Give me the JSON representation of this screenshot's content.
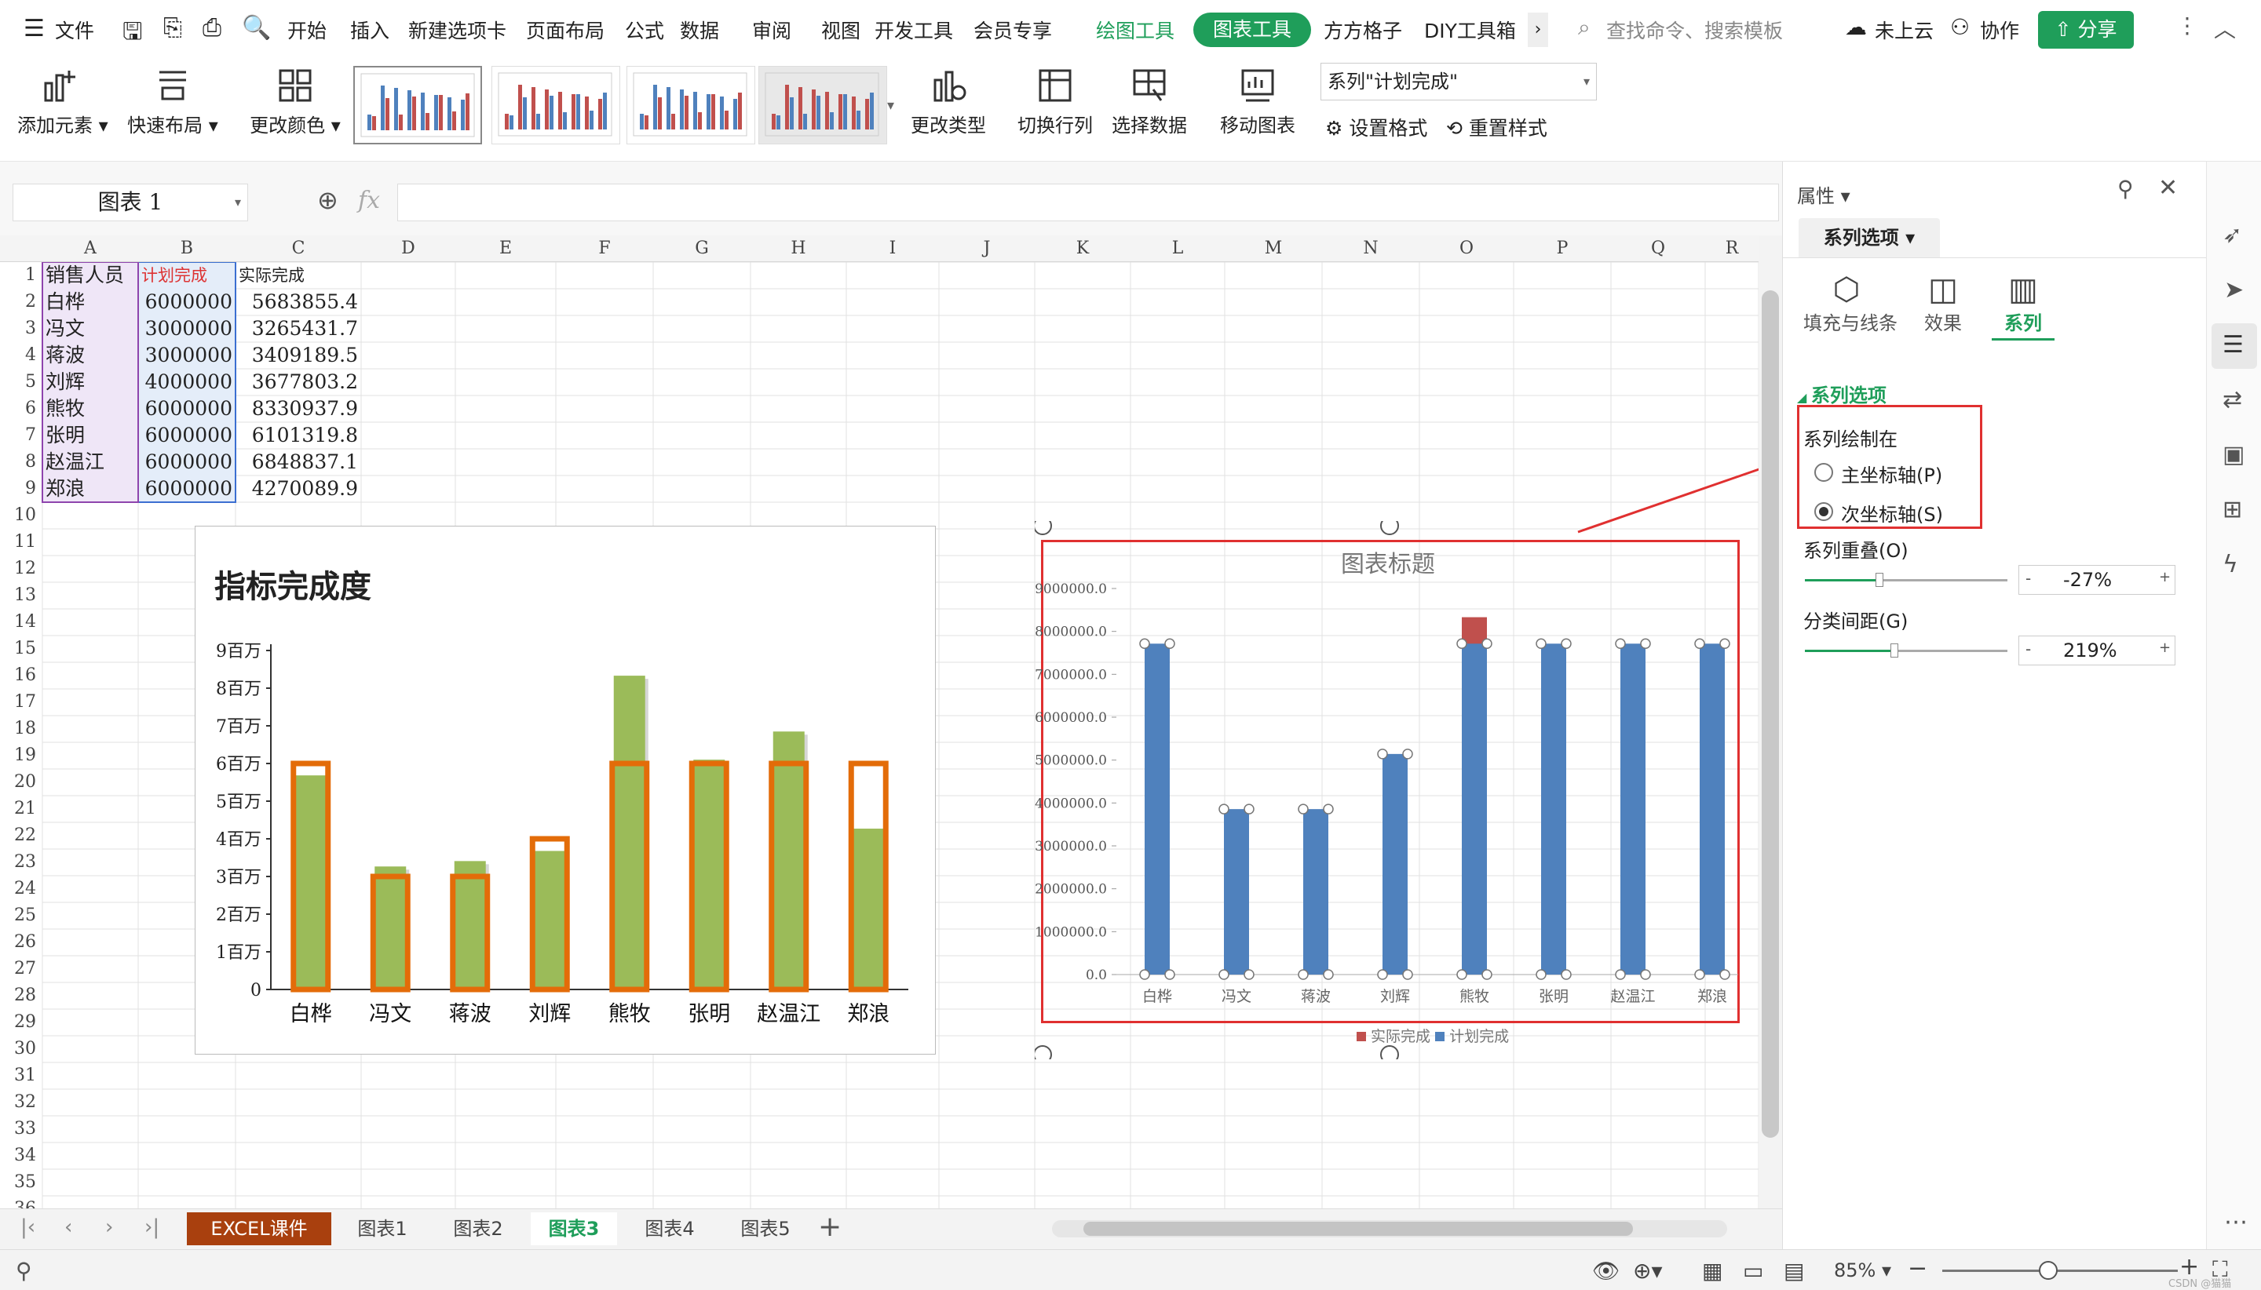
{
  "menu": {
    "file": "文件",
    "items": [
      "开始",
      "插入",
      "新建选项卡",
      "页面布局",
      "公式",
      "数据",
      "审阅",
      "视图",
      "开发工具",
      "会员专享"
    ],
    "drawing_tools": "绘图工具",
    "chart_tools": "图表工具",
    "fangfang": "方方格子",
    "diy": "DIY工具箱",
    "more": "›",
    "search_placeholder": "查找命令、搜索模板",
    "cloud": "未上云",
    "collab": "协作",
    "share": "分享"
  },
  "ribbon": {
    "add_element": "添加元素",
    "quick_layout": "快速布局",
    "change_color": "更改颜色",
    "change_type": "更改类型",
    "switch_rowcol": "切换行列",
    "select_data": "选择数据",
    "move_chart": "移动图表",
    "series_select": "系列\"计划完成\"",
    "set_format": "设置格式",
    "reset_style": "重置样式"
  },
  "formula_bar": {
    "name_box": "图表 1",
    "fx": "fx",
    "value": ""
  },
  "columns": [
    "A",
    "B",
    "C",
    "D",
    "E",
    "F",
    "G",
    "H",
    "I",
    "J",
    "K",
    "L",
    "M",
    "N",
    "O",
    "P",
    "Q",
    "R"
  ],
  "rows": [
    "1",
    "2",
    "3",
    "4",
    "5",
    "6",
    "7",
    "8",
    "9",
    "10",
    "11",
    "12",
    "13",
    "14",
    "15",
    "16",
    "17",
    "18",
    "19",
    "20",
    "21",
    "22",
    "23",
    "24",
    "25",
    "26",
    "27",
    "28",
    "29",
    "30",
    "31",
    "32",
    "33",
    "34",
    "35",
    "36"
  ],
  "table": {
    "headers": [
      "销售人员",
      "计划完成",
      "实际完成"
    ],
    "rows": [
      [
        "白桦",
        "6000000",
        "5683855.4"
      ],
      [
        "冯文",
        "3000000",
        "3265431.7"
      ],
      [
        "蒋波",
        "3000000",
        "3409189.5"
      ],
      [
        "刘辉",
        "4000000",
        "3677803.2"
      ],
      [
        "熊牧",
        "6000000",
        "8330937.9"
      ],
      [
        "张明",
        "6000000",
        "6101319.8"
      ],
      [
        "赵温江",
        "6000000",
        "6848837.1"
      ],
      [
        "郑浪",
        "6000000",
        "4270089.9"
      ]
    ]
  },
  "chart_data": [
    {
      "type": "bar",
      "title": "指标完成度",
      "categories": [
        "白桦",
        "冯文",
        "蒋波",
        "刘辉",
        "熊牧",
        "张明",
        "赵温江",
        "郑浪"
      ],
      "series": [
        {
          "values": [
            5683855.4,
            3265431.7,
            3409189.5,
            3677803.2,
            8330937.9,
            6101319.8,
            6848837.1,
            4270089.9
          ]
        },
        {
          "values": [
            6000000,
            3000000,
            3000000,
            4000000,
            6000000,
            6000000,
            6000000,
            6000000
          ]
        }
      ],
      "ylim": [
        0,
        9000000
      ],
      "yticks": [
        "0",
        "1百万",
        "2百万",
        "3百万",
        "4百万",
        "5百万",
        "6百万",
        "7百万",
        "8百万",
        "9百万"
      ],
      "colors": {
        "actual": "#9bbb59",
        "plan": "#e36c09"
      },
      "grid": false
    },
    {
      "type": "bar",
      "title": "图表标题",
      "categories": [
        "白桦",
        "冯文",
        "蒋波",
        "刘辉",
        "熊牧",
        "张明",
        "赵温江",
        "郑浪"
      ],
      "series": [
        {
          "name": "实际完成",
          "values": [
            5683855.4,
            3265431.7,
            3409189.5,
            3677803.2,
            8330937.9,
            6101319.8,
            6848837.1,
            4270089.9
          ]
        },
        {
          "name": "计划完成",
          "values": [
            6000000,
            3000000,
            3000000,
            4000000,
            6000000,
            6000000,
            6000000,
            6000000
          ]
        }
      ],
      "ylim": [
        0,
        9000000
      ],
      "secondary_ylim": [
        0,
        7000000
      ],
      "yticks": [
        "0.0",
        "1000000.0",
        "2000000.0",
        "3000000.0",
        "4000000.0",
        "5000000.0",
        "6000000.0",
        "7000000.0",
        "8000000.0",
        "9000000.0"
      ],
      "colors": {
        "actual": "#c0504d",
        "plan": "#4f81bd"
      },
      "legend": "bottom",
      "grid": false
    }
  ],
  "sheet_tabs": [
    "EXCEL课件",
    "图表1",
    "图表2",
    "图表3",
    "图表4",
    "图表5"
  ],
  "active_tab": "图表3",
  "panel": {
    "title": "属性",
    "section_tab": "系列选项",
    "subtabs": [
      "填充与线条",
      "效果",
      "系列"
    ],
    "section_header": "系列选项",
    "plot_on": "系列绘制在",
    "primary_axis": "主坐标轴(P)",
    "secondary_axis": "次坐标轴(S)",
    "selected_axis": "secondary",
    "overlap_label": "系列重叠(O)",
    "overlap_value": "-27%",
    "overlap_level": 0.37,
    "gap_label": "分类间距(G)",
    "gap_value": "219%",
    "gap_level": 0.44
  },
  "status": {
    "zoom": "85%",
    "zoom_level": 0.45,
    "watermark": "CSDN @猫猫"
  },
  "accent": "#1f9e5a"
}
